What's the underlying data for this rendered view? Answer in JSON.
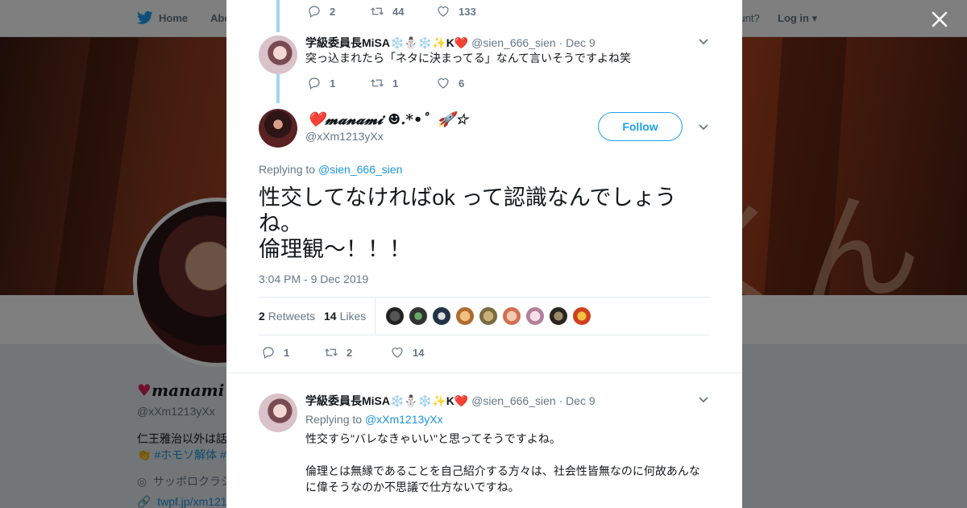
{
  "bg": {
    "nav_home": "Home",
    "nav_about": "Abo",
    "have_account": "account?",
    "login": "Log in",
    "profile_name": "manami",
    "profile_handle": "@xXm1213yXx",
    "bio": "仁王雅治以外は話",
    "tags": "#ホモソ解体 #",
    "location": "サッポロクラシ",
    "link": "twpf.jp/xm121",
    "banner_glyph": "くん"
  },
  "modal": {
    "top_actions": {
      "replies": "2",
      "retweets": "44",
      "likes": "133"
    },
    "reply1": {
      "name": "学級委員長MiSA❄️⛄❄️✨K❤️",
      "handle": "@sien_666_sien",
      "date": "· Dec 9",
      "text": "突っ込まれたら「ネタに決まってる」なんて言いそうですよね笑",
      "replies": "1",
      "retweets": "1",
      "likes": "6"
    },
    "main": {
      "name": "❤️𝓶𝓪𝓷𝓪𝓶𝓲 ☻.*•゜🚀☆",
      "handle": "@xXm1213yXx",
      "follow_label": "Follow",
      "replying_label": "Replying to",
      "replying_to": "@sien_666_sien",
      "text_line1": "性交してなければok って認識なんでしょう",
      "text_line2": "ね。",
      "text_line3": "倫理観～！！！",
      "timestamp": "3:04 PM - 9 Dec 2019",
      "retweets_count": "2",
      "retweets_label": "Retweets",
      "likes_count": "14",
      "likes_label": "Likes",
      "replies": "1",
      "retweets": "2",
      "likes": "14"
    },
    "reply2": {
      "name": "学級委員長MiSA❄️⛄❄️✨K❤️",
      "handle": "@sien_666_sien",
      "date": "· Dec 9",
      "replying_label": "Replying to",
      "replying_to": "@xXm1213yXx",
      "text_line1": "性交すら\"バレなきゃいい\"と思ってそうですよね。",
      "text_line2": "倫理とは無縁であることを自己紹介する方々は、社会性皆無なのに何故あんな",
      "text_line3": "に偉そうなのか不思議で仕方ないですね。"
    }
  },
  "colors": {
    "accent": "#1da1f2",
    "link": "#1b95e0",
    "muted": "#657786",
    "thread": "#a5d4f3"
  }
}
